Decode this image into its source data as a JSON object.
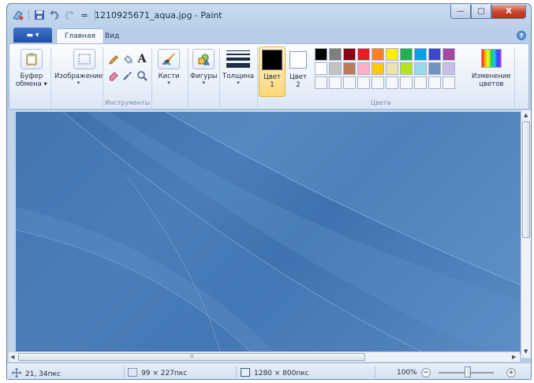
{
  "window": {
    "title": "1210925671_aqua.jpg - Paint",
    "controls": {
      "minimize": "—",
      "maximize": "□",
      "close": "X"
    }
  },
  "quick_access": {
    "icons": [
      "paint-icon",
      "save-icon",
      "undo-icon",
      "redo-icon",
      "customize-dropdown-icon"
    ],
    "dropdown_glyph": "="
  },
  "ribbon": {
    "tabs": [
      {
        "label": "Главная",
        "active": true
      },
      {
        "label": "Вид",
        "active": false
      }
    ],
    "file_menu_glyph": "▬ ▾",
    "help_glyph": "?",
    "groups": {
      "clipboard": {
        "label_line1": "Буфер",
        "label_line2": "обмена ▾"
      },
      "image": {
        "label": "Изображение",
        "arrow": "▾"
      },
      "tools": {
        "title": "Инструменты"
      },
      "brushes": {
        "label": "Кисти",
        "arrow": "▾"
      },
      "shapes": {
        "label": "Фигуры",
        "arrow": "▾"
      },
      "size": {
        "label": "Толщина",
        "arrow": "▾"
      },
      "color1": {
        "label_line1": "Цвет",
        "label_line2": "1",
        "color": "#000000"
      },
      "color2": {
        "label_line1": "Цвет",
        "label_line2": "2",
        "color": "#ffffff"
      },
      "colors": {
        "title": "Цвета",
        "palette_row1": [
          "#000000",
          "#7f7f7f",
          "#880015",
          "#ed1c24",
          "#ff7f27",
          "#fff200",
          "#22b14c",
          "#00a2e8",
          "#3f48cc",
          "#a349a4"
        ],
        "palette_row2": [
          "#ffffff",
          "#c3c3c3",
          "#b97a57",
          "#ffaec9",
          "#ffc90e",
          "#efe4b0",
          "#b5e61d",
          "#99d9ea",
          "#7092be",
          "#c8bfe7"
        ]
      },
      "edit_colors": {
        "label_line1": "Изменение",
        "label_line2": "цветов"
      }
    }
  },
  "status_bar": {
    "cursor_position": "21, 34пкс",
    "selection_size": "99 × 227пкс",
    "image_size": "1280 × 800пкс",
    "zoom": "100%",
    "zoom_minus": "−",
    "zoom_plus": "+"
  },
  "scrollbar": {
    "h_thumb_grip": "III"
  }
}
